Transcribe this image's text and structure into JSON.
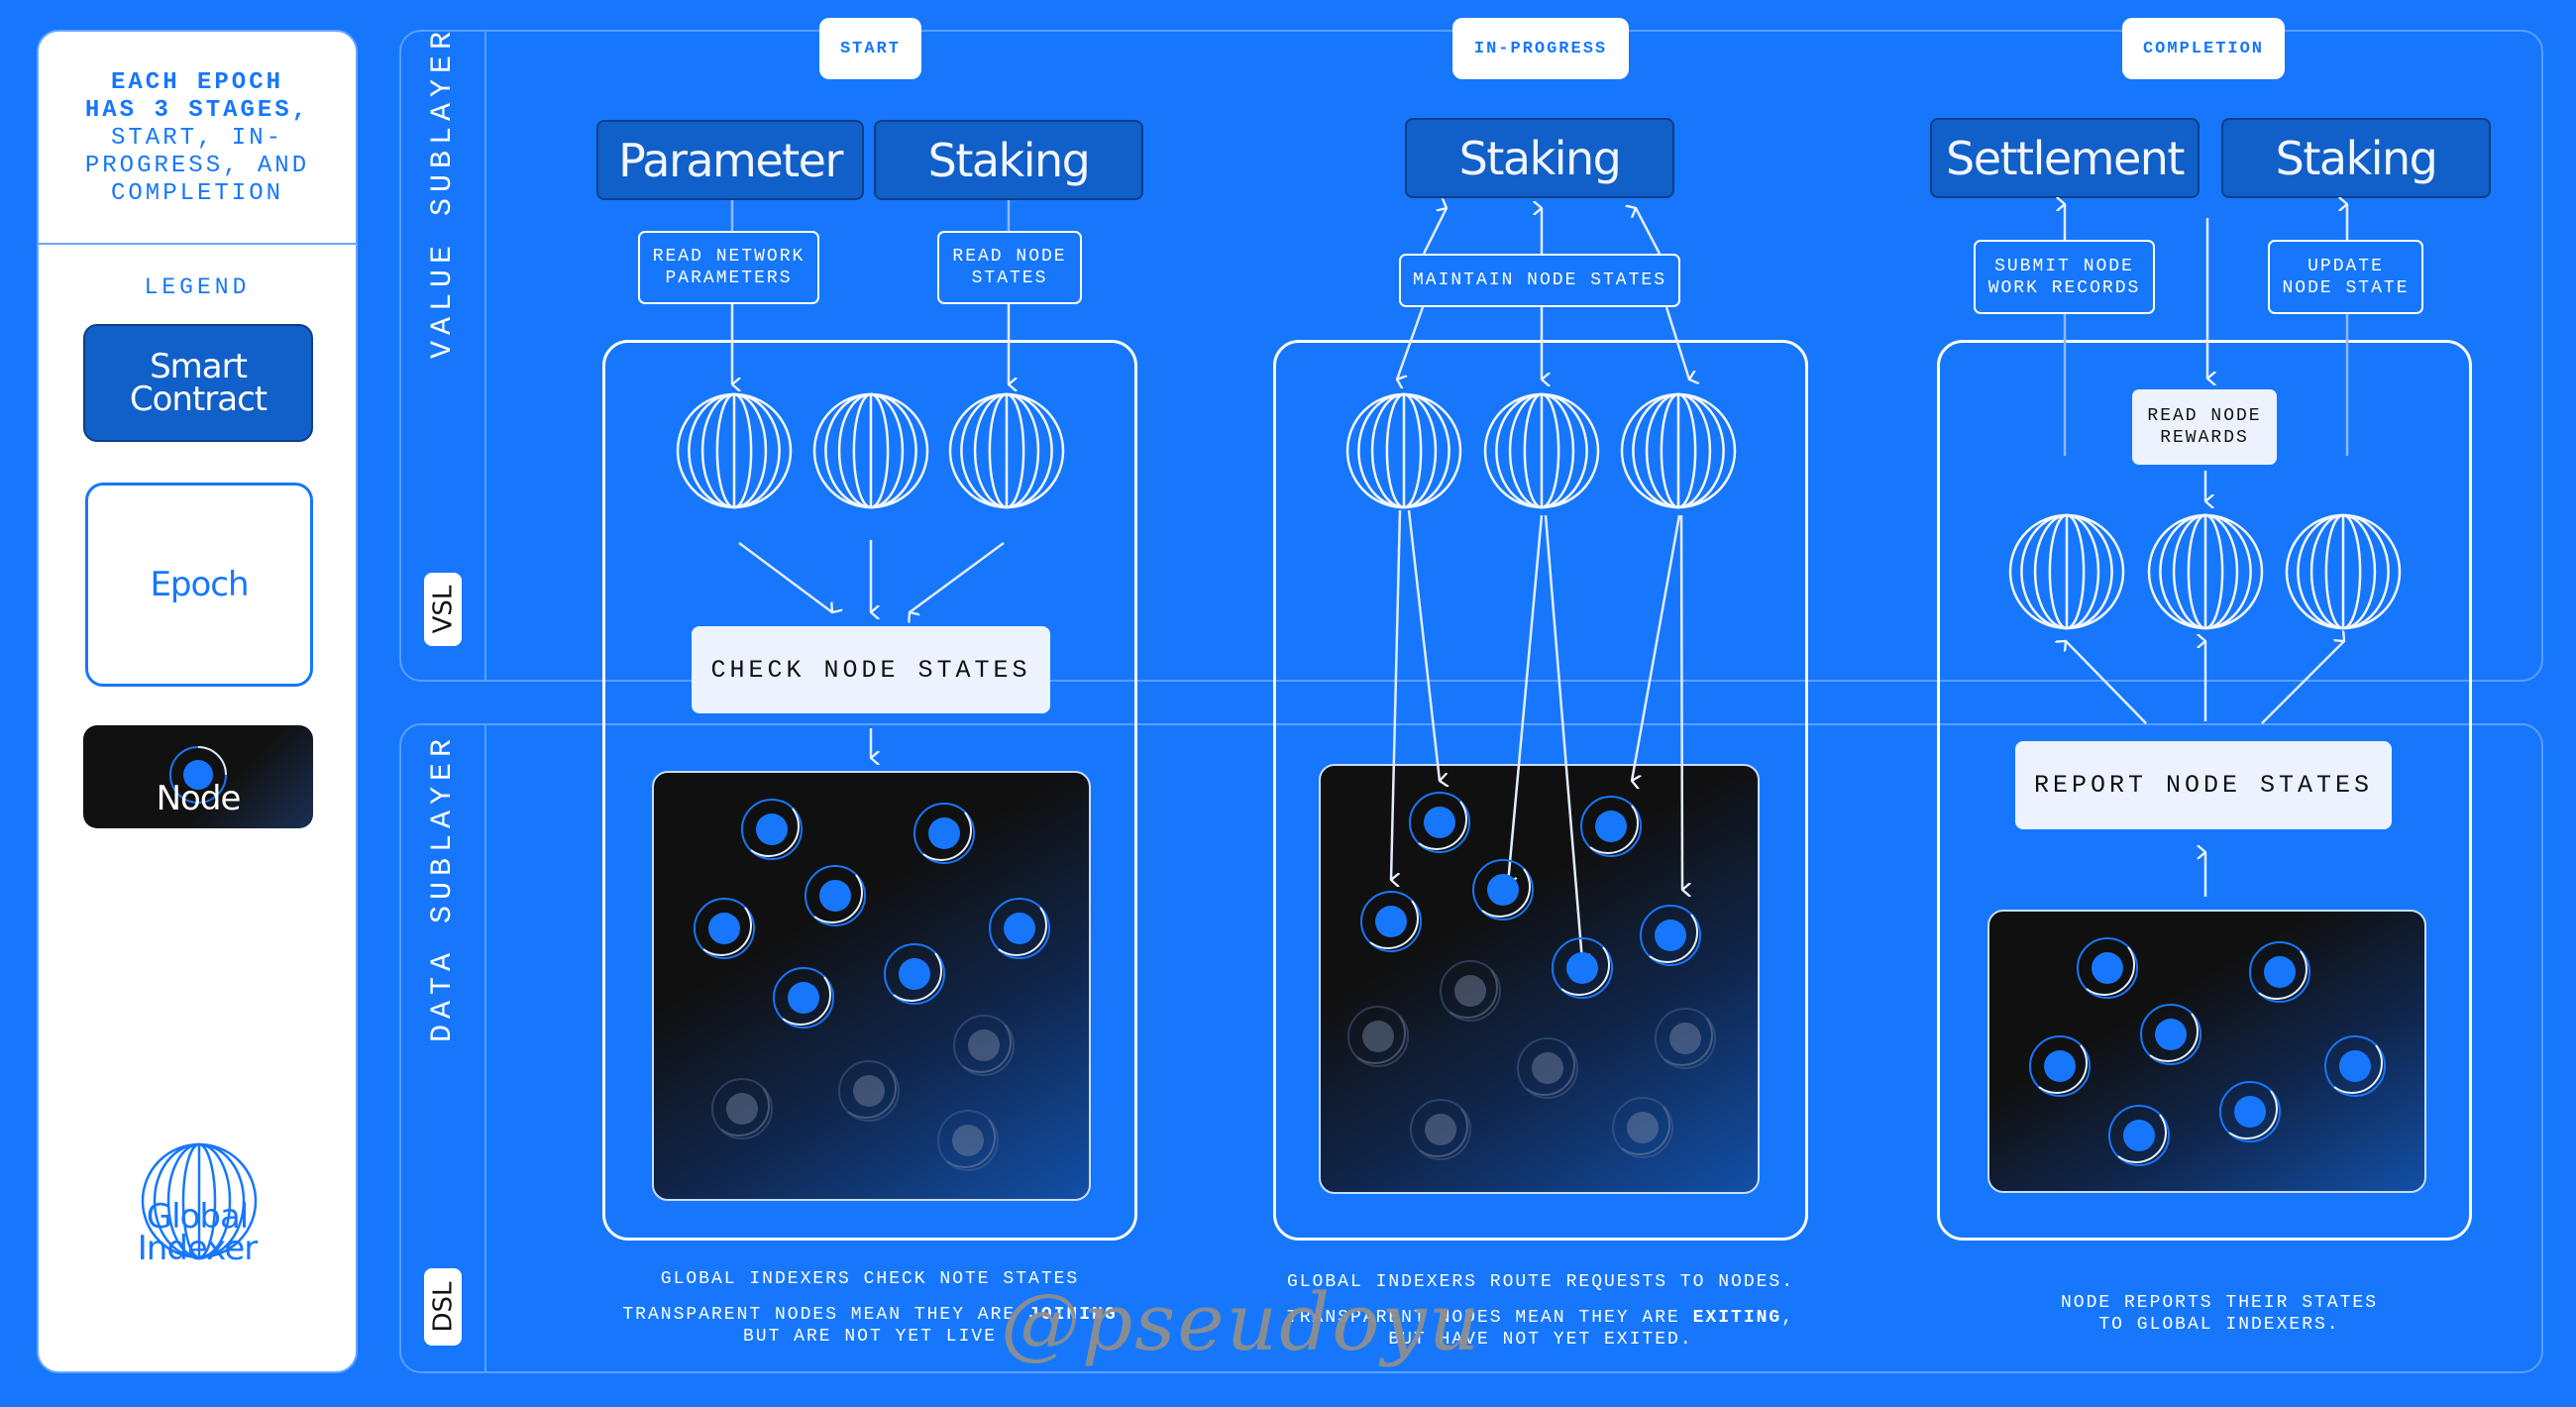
{
  "sidebar": {
    "heading_bold_1": "EACH EPOCH",
    "heading_bold_2": "HAS 3 STAGES,",
    "heading_normal_1": "START, IN-",
    "heading_normal_2": "PROGRESS, AND",
    "heading_normal_3": "COMPLETION",
    "legend_title": "LEGEND",
    "legend": {
      "smart_contract_1": "Smart",
      "smart_contract_2": "Contract",
      "epoch": "Epoch",
      "node": "Node",
      "global_indexer_1": "Global",
      "global_indexer_2": "Indexer"
    }
  },
  "layers": {
    "value_sublayer": "VALUE SUBLAYER",
    "vsl_tag": "VSL",
    "data_sublayer": "DATA SUBLAYER",
    "dsl_tag": "DSL"
  },
  "stages": [
    {
      "tag": "START",
      "contracts": [
        "Parameter",
        "Staking"
      ],
      "actions": [
        {
          "line1": "READ NETWORK",
          "line2": "PARAMETERS"
        },
        {
          "line1": "READ NODE",
          "line2": "STATES"
        }
      ],
      "main_action": "CHECK NODE STATES",
      "caption_line1": "GLOBAL INDEXERS CHECK NOTE STATES",
      "caption_line2_pre": "TRANSPARENT NODES MEAN THEY ARE ",
      "caption_line2_bold": "JOINING",
      "caption_line2_post": "",
      "caption_line3": "BUT ARE NOT YET LIVE",
      "active_nodes": 7,
      "transparent_nodes": 4
    },
    {
      "tag": "IN-PROGRESS",
      "contracts": [
        "Staking"
      ],
      "actions": [
        {
          "line1": "MAINTAIN NODE STATES",
          "line2": ""
        }
      ],
      "caption_line1": "GLOBAL INDEXERS ROUTE REQUESTS TO NODES.",
      "caption_line2_pre": "TRANSPARENT NODES MEAN THEY ARE ",
      "caption_line2_bold": "EXITING",
      "caption_line2_post": ",",
      "caption_line3": "BUT HAVE NOT YET EXITED.",
      "active_nodes": 6,
      "transparent_nodes": 6
    },
    {
      "tag": "COMPLETION",
      "contracts": [
        "Settlement",
        "Staking"
      ],
      "actions": [
        {
          "line1": "SUBMIT NODE",
          "line2": "WORK RECORDS"
        },
        {
          "line1": "UPDATE",
          "line2": "NODE STATE"
        },
        {
          "line1": "READ NODE",
          "line2": "REWARDS"
        }
      ],
      "main_action": "REPORT NODE STATES",
      "caption_line1": "NODE REPORTS THEIR STATES",
      "caption_line2": "TO GLOBAL INDEXERS.",
      "active_nodes": 7,
      "transparent_nodes": 0
    }
  ],
  "watermark": "@pseudoyu",
  "colors": {
    "background": "#1677fc",
    "contract_fill": "#115fc8",
    "node_dot": "#1677fc",
    "panel_dark": "#101010",
    "text_dark": "#111111",
    "light_box": "#ecf3ff"
  }
}
